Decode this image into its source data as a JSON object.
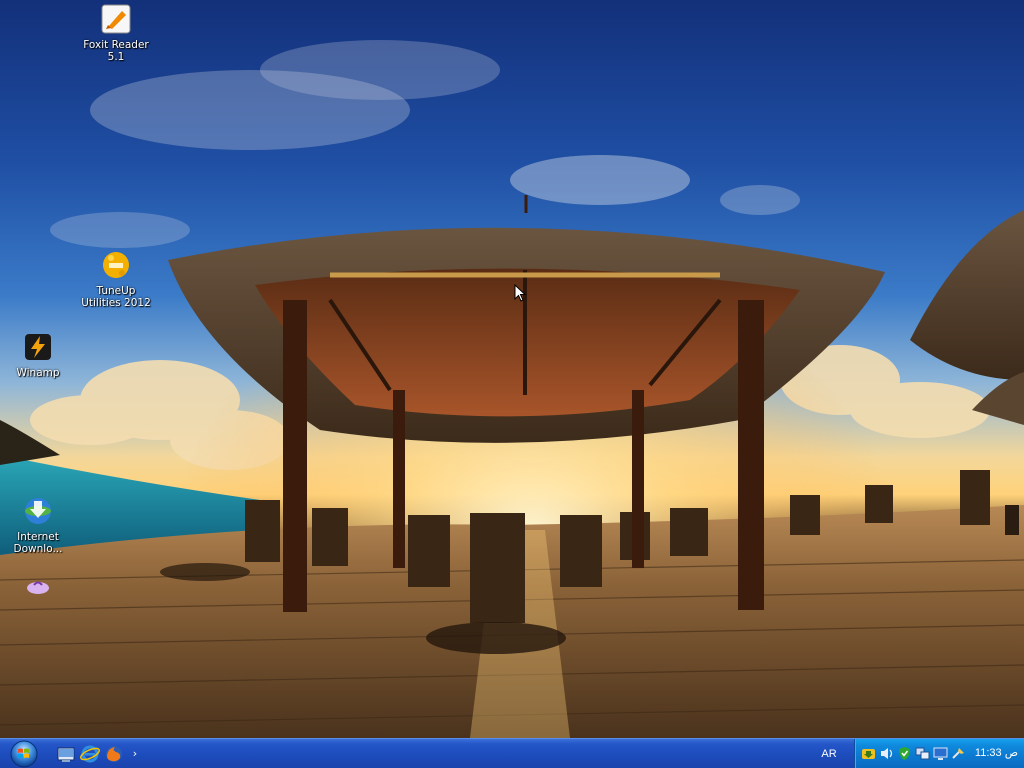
{
  "desktop": {
    "icons": [
      {
        "label": "Foxit Reader 5.1",
        "icon": "foxit-reader-icon"
      },
      {
        "label": "TuneUp Utilities 2012",
        "icon": "tuneup-utilities-icon"
      },
      {
        "label": "Winamp",
        "icon": "winamp-icon"
      },
      {
        "label": "Internet Downlo...",
        "icon": "internet-download-manager-icon"
      },
      {
        "label": "",
        "icon": "unknown-shortcut-icon"
      }
    ]
  },
  "taskbar": {
    "start_icon": "windows-start-orb",
    "quick_launch": [
      "show-desktop-icon",
      "internet-explorer-icon",
      "firefox-icon"
    ],
    "quick_launch_more": "›",
    "language": "AR",
    "tray_icons": [
      "idm-tray-icon",
      "volume-icon",
      "security-shield-icon",
      "network-icon",
      "display-icon",
      "hardware-icon"
    ],
    "clock": "11:33 ص"
  },
  "colors": {
    "taskbar": "#1d4cbc",
    "tray": "#0c78cf",
    "sky": "#1f4fa4",
    "deck": "#6b4a2b"
  }
}
